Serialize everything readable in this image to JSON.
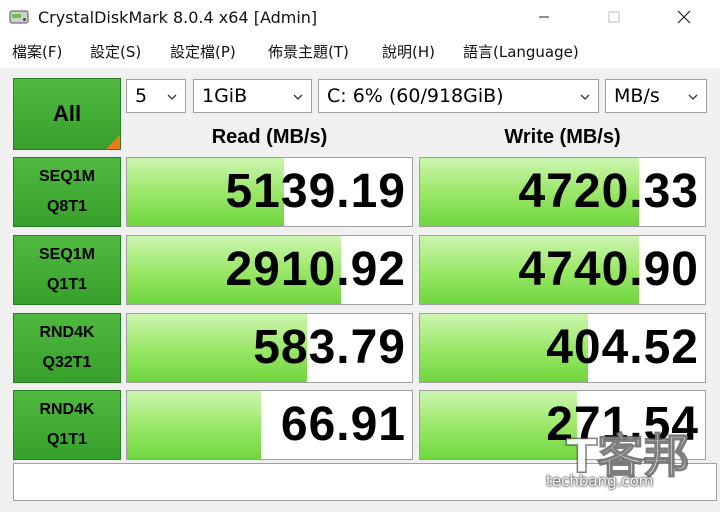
{
  "window": {
    "title": "CrystalDiskMark 8.0.4 x64 [Admin]"
  },
  "menu": [
    {
      "label": "檔案(F)"
    },
    {
      "label": "設定(S)"
    },
    {
      "label": "設定檔(P)"
    },
    {
      "label": "佈景主題(T)"
    },
    {
      "label": "說明(H)"
    },
    {
      "label": "語言(Language)"
    }
  ],
  "toolbar": {
    "all_label": "All",
    "count": "5",
    "size": "1GiB",
    "drive": "C: 6% (60/918GiB)",
    "unit": "MB/s"
  },
  "headers": {
    "read": "Read (MB/s)",
    "write": "Write (MB/s)"
  },
  "tests": [
    {
      "line1": "SEQ1M",
      "line2": "Q8T1",
      "read": "5139.19",
      "write": "4720.33",
      "read_fill": 0.55,
      "write_fill": 0.77
    },
    {
      "line1": "SEQ1M",
      "line2": "Q1T1",
      "read": "2910.92",
      "write": "4740.90",
      "read_fill": 0.75,
      "write_fill": 0.77
    },
    {
      "line1": "RND4K",
      "line2": "Q32T1",
      "read": "583.79",
      "write": "404.52",
      "read_fill": 0.63,
      "write_fill": 0.59
    },
    {
      "line1": "RND4K",
      "line2": "Q1T1",
      "read": "66.91",
      "write": "271.54",
      "read_fill": 0.47,
      "write_fill": 0.55
    }
  ],
  "watermark": {
    "mark": "T客邦",
    "site": "techbang.com"
  },
  "colors": {
    "button_green": "#3fab32",
    "bar_green": "#9ce86a",
    "corner_orange": "#f07a1a"
  }
}
